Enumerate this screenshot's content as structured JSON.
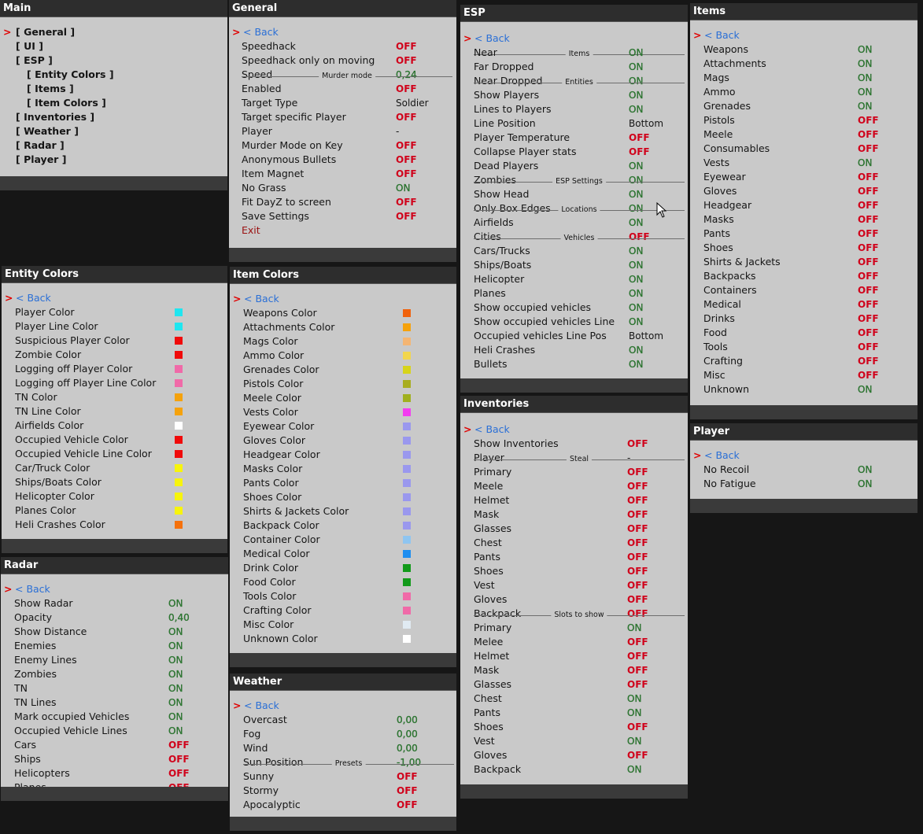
{
  "labels": {
    "on": "ON",
    "off": "OFF",
    "back_arrow": ">",
    "back": "< Back"
  },
  "colors": {
    "on": "#2e7d32",
    "off": "#d0021b",
    "back": "#2a6fd6",
    "panel_bg": "#c9c9c9",
    "header_bg": "#2d2d2d",
    "page_bg": "#161616"
  },
  "main": {
    "title": "Main",
    "items": [
      {
        "label": "[ General ]",
        "selected": true
      },
      {
        "label": "[ UI ]"
      },
      {
        "label": "[ ESP ]"
      },
      {
        "label": "[ Entity Colors ]"
      },
      {
        "label": "[ Items ]"
      },
      {
        "label": "[ Item Colors ]"
      },
      {
        "label": "[ Inventories ]"
      },
      {
        "label": "[ Weather ]"
      },
      {
        "label": "[ Radar ]"
      },
      {
        "label": "[ Player ]"
      }
    ]
  },
  "general": {
    "title": "General",
    "rows": [
      {
        "label": "Speedhack",
        "value": "OFF"
      },
      {
        "label": "Speedhack only on moving",
        "value": "OFF"
      },
      {
        "label": "Speed",
        "value": "0,24"
      },
      {
        "section": "Murder mode"
      },
      {
        "label": "Enabled",
        "value": "OFF"
      },
      {
        "label": "Target Type",
        "value": "Soldier"
      },
      {
        "label": "Target specific Player",
        "value": "OFF"
      },
      {
        "label": "Player",
        "value": "-"
      },
      {
        "label": "Murder Mode on Key",
        "value": "OFF"
      },
      {
        "label": "Anonymous Bullets",
        "value": "OFF"
      },
      {
        "label": "Item Magnet",
        "value": "OFF"
      },
      {
        "label": "No Grass",
        "value": "ON"
      },
      {
        "label": "Fit DayZ to screen",
        "value": "OFF"
      },
      {
        "label": "Save Settings",
        "value": "OFF"
      },
      {
        "label": "Exit"
      }
    ]
  },
  "esp": {
    "title": "ESP",
    "rows": [
      {
        "section": "Items"
      },
      {
        "label": "Near",
        "value": "ON"
      },
      {
        "label": "Far Dropped",
        "value": "ON"
      },
      {
        "label": "Near Dropped",
        "value": "ON"
      },
      {
        "section": "Entities"
      },
      {
        "label": "Show Players",
        "value": "ON"
      },
      {
        "label": "Lines to Players",
        "value": "ON"
      },
      {
        "label": "Line Position",
        "value": "Bottom"
      },
      {
        "label": "Player Temperature",
        "value": "OFF"
      },
      {
        "label": "Collapse Player stats",
        "value": "OFF"
      },
      {
        "label": "Dead Players",
        "value": "ON"
      },
      {
        "label": "Zombies",
        "value": "ON"
      },
      {
        "section": "ESP Settings"
      },
      {
        "label": "Show Head",
        "value": "ON"
      },
      {
        "label": "Only Box Edges",
        "value": "ON"
      },
      {
        "section": "Locations"
      },
      {
        "label": "Airfields",
        "value": "ON"
      },
      {
        "label": "Cities",
        "value": "OFF"
      },
      {
        "section": "Vehicles"
      },
      {
        "label": "Cars/Trucks",
        "value": "ON"
      },
      {
        "label": "Ships/Boats",
        "value": "ON"
      },
      {
        "label": "Helicopter",
        "value": "ON"
      },
      {
        "label": "Planes",
        "value": "ON"
      },
      {
        "label": "Show occupied vehicles",
        "value": "ON"
      },
      {
        "label": "Show occupied vehicles Line",
        "value": "ON"
      },
      {
        "label": "Occupied vehicles Line Pos",
        "value": "Bottom"
      },
      {
        "label": "Heli Crashes",
        "value": "ON"
      },
      {
        "label": "Bullets",
        "value": "ON"
      }
    ]
  },
  "items": {
    "title": "Items",
    "rows": [
      {
        "label": "Weapons",
        "value": "ON"
      },
      {
        "label": "Attachments",
        "value": "ON"
      },
      {
        "label": "Mags",
        "value": "ON"
      },
      {
        "label": "Ammo",
        "value": "ON"
      },
      {
        "label": "Grenades",
        "value": "ON"
      },
      {
        "label": "Pistols",
        "value": "OFF"
      },
      {
        "label": "Meele",
        "value": "OFF"
      },
      {
        "label": "Consumables",
        "value": "OFF"
      },
      {
        "label": "Vests",
        "value": "ON"
      },
      {
        "label": "Eyewear",
        "value": "OFF"
      },
      {
        "label": "Gloves",
        "value": "OFF"
      },
      {
        "label": "Headgear",
        "value": "OFF"
      },
      {
        "label": "Masks",
        "value": "OFF"
      },
      {
        "label": "Pants",
        "value": "OFF"
      },
      {
        "label": "Shoes",
        "value": "OFF"
      },
      {
        "label": "Shirts & Jackets",
        "value": "OFF"
      },
      {
        "label": "Backpacks",
        "value": "OFF"
      },
      {
        "label": "Containers",
        "value": "OFF"
      },
      {
        "label": "Medical",
        "value": "OFF"
      },
      {
        "label": "Drinks",
        "value": "OFF"
      },
      {
        "label": "Food",
        "value": "OFF"
      },
      {
        "label": "Tools",
        "value": "OFF"
      },
      {
        "label": "Crafting",
        "value": "OFF"
      },
      {
        "label": "Misc",
        "value": "OFF"
      },
      {
        "label": "Unknown",
        "value": "ON"
      }
    ]
  },
  "player": {
    "title": "Player",
    "rows": [
      {
        "label": "No Recoil",
        "value": "ON"
      },
      {
        "label": "No Fatigue",
        "value": "ON"
      }
    ]
  },
  "entity_colors": {
    "title": "Entity Colors",
    "rows": [
      {
        "label": "Player Color",
        "color": "#1fe6f0"
      },
      {
        "label": "Player Line Color",
        "color": "#1fe6f0"
      },
      {
        "label": "Suspicious Player Color",
        "color": "#f00a0a"
      },
      {
        "label": "Zombie Color",
        "color": "#f00a0a"
      },
      {
        "label": "Logging off Player Color",
        "color": "#f06aa8"
      },
      {
        "label": "Logging off Player Line Color",
        "color": "#f06aa8"
      },
      {
        "label": "TN Color",
        "color": "#f5a20c"
      },
      {
        "label": "TN Line Color",
        "color": "#f5a20c"
      },
      {
        "label": "Airfields Color",
        "color": "#ffffff"
      },
      {
        "label": "Occupied Vehicle Color",
        "color": "#f00a0a"
      },
      {
        "label": "Occupied Vehicle Line Color",
        "color": "#f00a0a"
      },
      {
        "label": "Car/Truck Color",
        "color": "#f7f40c"
      },
      {
        "label": "Ships/Boats Color",
        "color": "#f7f40c"
      },
      {
        "label": "Helicopter Color",
        "color": "#f7f40c"
      },
      {
        "label": "Planes Color",
        "color": "#f7f40c"
      },
      {
        "label": "Heli Crashes Color",
        "color": "#f5710c"
      }
    ]
  },
  "item_colors": {
    "title": "Item Colors",
    "rows": [
      {
        "label": "Weapons Color",
        "color": "#f0620c"
      },
      {
        "label": "Attachments Color",
        "color": "#f5a20c"
      },
      {
        "label": "Mags Color",
        "color": "#f4b573"
      },
      {
        "label": "Ammo Color",
        "color": "#f2d64d"
      },
      {
        "label": "Grenades Color",
        "color": "#d7d41a"
      },
      {
        "label": "Pistols Color",
        "color": "#a8ad1f"
      },
      {
        "label": "Meele Color",
        "color": "#a0b01e"
      },
      {
        "label": "Vests Color",
        "color": "#f23df0"
      },
      {
        "label": "Eyewear Color",
        "color": "#9a98ee"
      },
      {
        "label": "Gloves Color",
        "color": "#9a98ee"
      },
      {
        "label": "Headgear Color",
        "color": "#9a98ee"
      },
      {
        "label": "Masks Color",
        "color": "#9a98ee"
      },
      {
        "label": "Pants Color",
        "color": "#9a98ee"
      },
      {
        "label": "Shoes Color",
        "color": "#9a98ee"
      },
      {
        "label": "Shirts & Jackets Color",
        "color": "#9a98ee"
      },
      {
        "label": "Backpack Color",
        "color": "#9a98ee"
      },
      {
        "label": "Container Color",
        "color": "#8fc5f0"
      },
      {
        "label": "Medical Color",
        "color": "#1e8ef0"
      },
      {
        "label": "Drink Color",
        "color": "#129a1a"
      },
      {
        "label": "Food Color",
        "color": "#129a1a"
      },
      {
        "label": "Tools Color",
        "color": "#f06aa8"
      },
      {
        "label": "Crafting Color",
        "color": "#f06aa8"
      },
      {
        "label": "Misc Color",
        "color": "#e0eaf2"
      },
      {
        "label": "Unknown Color",
        "color": "#ffffff"
      }
    ]
  },
  "inventories": {
    "title": "Inventories",
    "rows": [
      {
        "label": "Show Inventories",
        "value": "OFF"
      },
      {
        "label": "Player",
        "value": "-"
      },
      {
        "section": "Steal"
      },
      {
        "label": "Primary",
        "value": "OFF"
      },
      {
        "label": "Meele",
        "value": "OFF"
      },
      {
        "label": "Helmet",
        "value": "OFF"
      },
      {
        "label": "Mask",
        "value": "OFF"
      },
      {
        "label": "Glasses",
        "value": "OFF"
      },
      {
        "label": "Chest",
        "value": "OFF"
      },
      {
        "label": "Pants",
        "value": "OFF"
      },
      {
        "label": "Shoes",
        "value": "OFF"
      },
      {
        "label": "Vest",
        "value": "OFF"
      },
      {
        "label": "Gloves",
        "value": "OFF"
      },
      {
        "label": "Backpack",
        "value": "OFF"
      },
      {
        "section": "Slots to show"
      },
      {
        "label": "Primary",
        "value": "ON"
      },
      {
        "label": "Melee",
        "value": "OFF"
      },
      {
        "label": "Helmet",
        "value": "OFF"
      },
      {
        "label": "Mask",
        "value": "OFF"
      },
      {
        "label": "Glasses",
        "value": "OFF"
      },
      {
        "label": "Chest",
        "value": "ON"
      },
      {
        "label": "Pants",
        "value": "ON"
      },
      {
        "label": "Shoes",
        "value": "OFF"
      },
      {
        "label": "Vest",
        "value": "ON"
      },
      {
        "label": "Gloves",
        "value": "OFF"
      },
      {
        "label": "Backpack",
        "value": "ON"
      }
    ]
  },
  "radar": {
    "title": "Radar",
    "rows": [
      {
        "label": "Show Radar",
        "value": "ON"
      },
      {
        "label": "Opacity",
        "value": "0,40"
      },
      {
        "label": "Show Distance",
        "value": "ON"
      },
      {
        "label": "Enemies",
        "value": "ON"
      },
      {
        "label": "Enemy Lines",
        "value": "ON"
      },
      {
        "label": "Zombies",
        "value": "ON"
      },
      {
        "label": "TN",
        "value": "ON"
      },
      {
        "label": "TN Lines",
        "value": "ON"
      },
      {
        "label": "Mark occupied Vehicles",
        "value": "ON"
      },
      {
        "label": "Occupied Vehicle Lines",
        "value": "ON"
      },
      {
        "label": "Cars",
        "value": "OFF"
      },
      {
        "label": "Ships",
        "value": "OFF"
      },
      {
        "label": "Helicopters",
        "value": "OFF"
      },
      {
        "label": "Planes",
        "value": "OFF"
      }
    ]
  },
  "weather": {
    "title": "Weather",
    "rows": [
      {
        "label": "Overcast",
        "value": "0,00"
      },
      {
        "label": "Fog",
        "value": "0,00"
      },
      {
        "label": "Wind",
        "value": "0,00"
      },
      {
        "label": "Sun Position",
        "value": "-1,00"
      },
      {
        "section": "Presets"
      },
      {
        "label": "Sunny",
        "value": "OFF"
      },
      {
        "label": "Stormy",
        "value": "OFF"
      },
      {
        "label": "Apocalyptic",
        "value": "OFF"
      }
    ]
  }
}
